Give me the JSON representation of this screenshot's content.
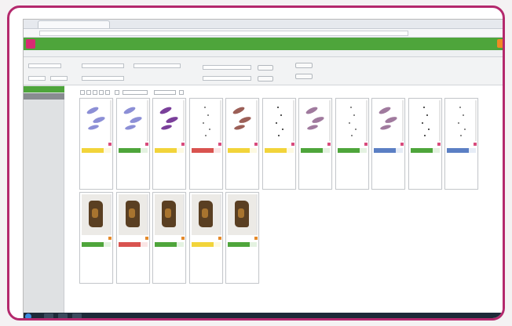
{
  "colors": {
    "frame": "#b4296d",
    "header": "#4ea53b",
    "logo": "#d62b72",
    "avatar": "#f08a24"
  },
  "icons": [
    "logo-icon",
    "flag-icon",
    "start-orb-icon"
  ],
  "cards_row1": [
    {
      "status_color": "#f2d43a",
      "specimen": "blue-oval",
      "flag": "pink"
    },
    {
      "status_color": "#4ea53b",
      "specimen": "blue-oval",
      "flag": "pink"
    },
    {
      "status_color": "#f2d43a",
      "specimen": "purple-oval",
      "flag": "pink"
    },
    {
      "status_color": "#d9534f",
      "specimen": "dots",
      "flag": "pink"
    },
    {
      "status_color": "#f2d43a",
      "specimen": "brown-oval",
      "flag": "pink"
    },
    {
      "status_color": "#f2d43a",
      "specimen": "black-dots",
      "flag": "pink"
    },
    {
      "status_color": "#4ea53b",
      "specimen": "mauve-oval",
      "flag": "pink"
    },
    {
      "status_color": "#4ea53b",
      "specimen": "dots",
      "flag": "pink"
    },
    {
      "status_color": "#5b7fc4",
      "specimen": "mauve-oval",
      "flag": "pink"
    },
    {
      "status_color": "#4ea53b",
      "specimen": "black-dots",
      "flag": "pink"
    },
    {
      "status_color": "#5b7fc4",
      "specimen": "dots",
      "flag": "pink"
    }
  ],
  "cards_row2": [
    {
      "status_color": "#4ea53b",
      "specimen": "photo",
      "flag": "orange"
    },
    {
      "status_color": "#d9534f",
      "specimen": "photo",
      "flag": "orange"
    },
    {
      "status_color": "#4ea53b",
      "specimen": "photo",
      "flag": "orange"
    },
    {
      "status_color": "#f2d43a",
      "specimen": "photo",
      "flag": "orange"
    },
    {
      "status_color": "#4ea53b",
      "specimen": "photo",
      "flag": "orange"
    }
  ]
}
